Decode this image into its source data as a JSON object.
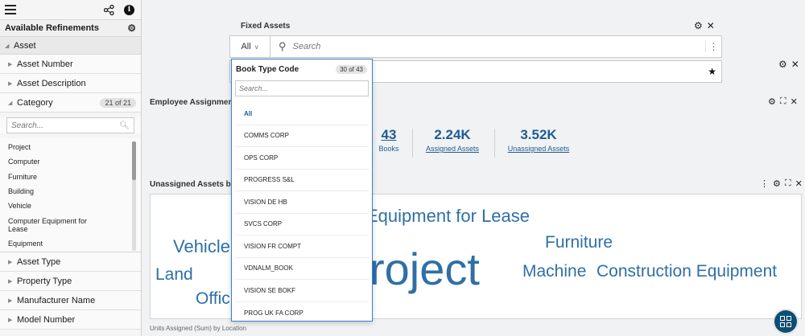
{
  "sidebar": {
    "header": "Available Refinements",
    "group": "Asset",
    "items_top": [
      {
        "label": "Asset Number"
      },
      {
        "label": "Asset Description"
      }
    ],
    "category": {
      "label": "Category",
      "count": "21 of 21",
      "search_placeholder": "Search..."
    },
    "category_values": [
      "Project",
      "Computer",
      "Furniture",
      "Building",
      "Vehicle",
      "Computer Equipment for Lease",
      "Equipment"
    ],
    "items_bottom": [
      {
        "label": "Asset Type"
      },
      {
        "label": "Property Type"
      },
      {
        "label": "Manufacturer Name"
      },
      {
        "label": "Model Number"
      }
    ]
  },
  "fixed_assets": {
    "title": "Fixed Assets",
    "all_label": "All",
    "search_placeholder": "Search"
  },
  "dropdown": {
    "title": "Book Type Code",
    "count": "30 of 43",
    "search_placeholder": "Search...",
    "items": [
      "All",
      "COMMS CORP",
      "OPS CORP",
      "PROGRESS S&L",
      "VISION DE HB",
      "SVCS CORP",
      "VISION FR COMPT",
      "VDNALM_BOOK",
      "VISION SE BOKF",
      "PROG UK FA CORP"
    ]
  },
  "employee_section": {
    "title": "Employee Assignment",
    "kpis": [
      {
        "value": "43",
        "label": "Books"
      },
      {
        "value": "2.24K",
        "label": "Assigned Assets"
      },
      {
        "value": "3.52K",
        "label": "Unassigned Assets"
      }
    ]
  },
  "unassigned_section": {
    "title": "Unassigned Assets by",
    "words": [
      "Equipment for Lease",
      "Vehicle",
      "Furniture",
      "Land",
      "roject",
      "Machine",
      "Construction Equipment",
      "Offic"
    ]
  },
  "bottom_text": "Units Assigned (Sum) by Location",
  "colors": {
    "accent": "#2f6fa7",
    "fab": "#0c4f73",
    "dropdown_border": "#3b82c8"
  }
}
